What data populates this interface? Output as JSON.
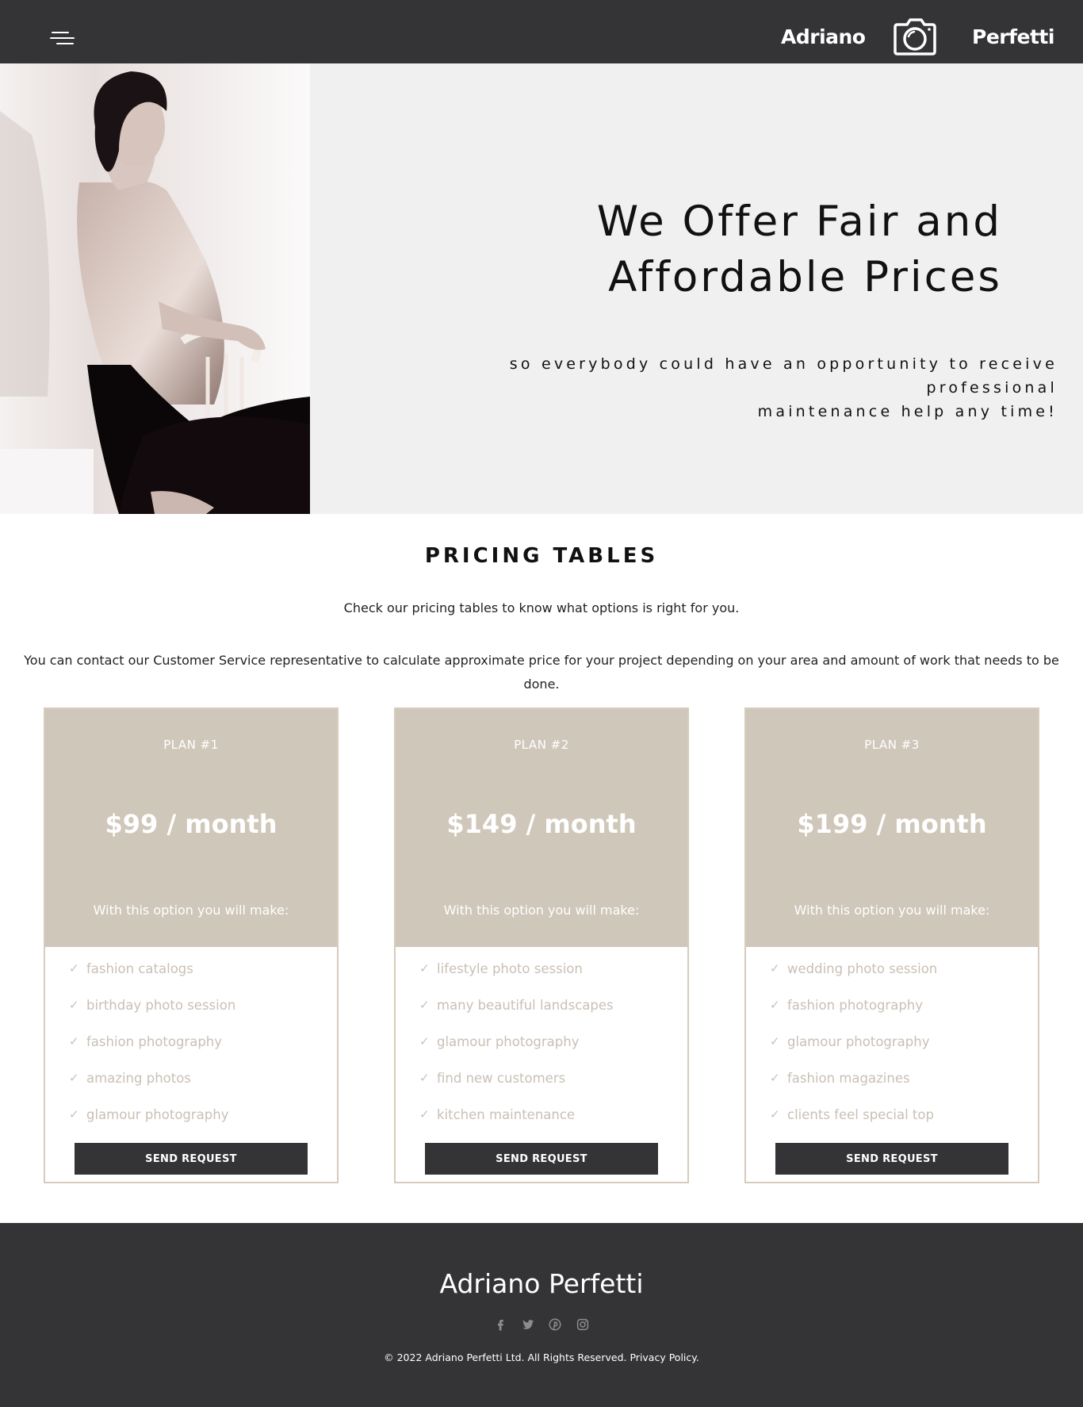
{
  "header": {
    "brand_first": "Adriano",
    "brand_last": "Perfetti",
    "logo_icon": "camera-icon",
    "menu_icon": "hamburger-menu-icon"
  },
  "hero": {
    "title_line1": "We Offer Fair and",
    "title_line2": "Affordable Prices",
    "subtitle_line1": "so everybody could have an opportunity to receive professional",
    "subtitle_line2": "maintenance help any time!"
  },
  "pricing": {
    "title": "PRICING TABLES",
    "intro": "Check our pricing tables to know what options is right for you.",
    "description": "You can contact our Customer Service representative to calculate approximate price for your project depending on your area and amount of work that needs to be done.",
    "plans": [
      {
        "name": "PLAN #1",
        "price": "$99 / month",
        "tagline": "With this option you will make:",
        "features": [
          "fashion catalogs",
          "birthday photo session",
          "fashion photography",
          "amazing photos",
          "glamour photography"
        ],
        "button": "SEND REQUEST"
      },
      {
        "name": "PLAN #2",
        "price": "$149 / month",
        "tagline": "With this option you will make:",
        "features": [
          "lifestyle photo session",
          "many beautiful landscapes",
          "glamour photography",
          "find new customers",
          "kitchen maintenance"
        ],
        "button": "SEND REQUEST"
      },
      {
        "name": "PLAN #3",
        "price": "$199 / month",
        "tagline": "With this option you will make:",
        "features": [
          "wedding photo session",
          "fashion photography",
          "glamour photography",
          "fashion magazines",
          "clients feel special top"
        ],
        "button": "SEND REQUEST"
      }
    ],
    "check_glyph": "✓"
  },
  "footer": {
    "brand": "Adriano Perfetti",
    "socials": [
      "facebook-icon",
      "twitter-icon",
      "pinterest-icon",
      "instagram-icon"
    ],
    "copyright": "© 2022 Adriano Perfetti Ltd. All Rights Reserved.",
    "privacy_link": "Privacy Policy."
  },
  "colors": {
    "dark": "#343436",
    "hero_bg": "#f1f0f1",
    "card_accent": "#d0c7bb",
    "feature_text": "#c9c0b5"
  }
}
